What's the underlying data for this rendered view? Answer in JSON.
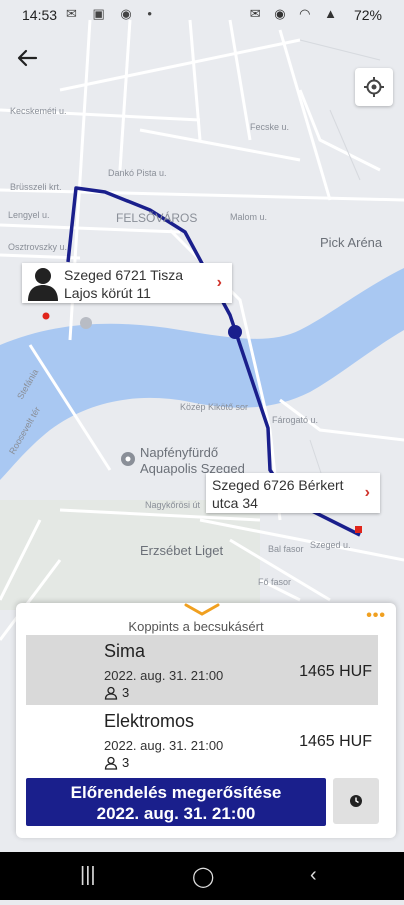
{
  "status": {
    "time": "14:53",
    "battery": "72%"
  },
  "map": {
    "labels": {
      "felsovaros": "FELSŐVÁROS",
      "pick_arena": "Pick Aréna",
      "napfenyfurdo_1": "Napfényfürdő",
      "napfenyfurdo_2": "Aquapolis Szeged",
      "erzsebet_liget": "Erzsébet Liget",
      "kecskemeti": "Kecskeméti u.",
      "brusszeli": "Brüsszeli krt.",
      "lengyel": "Lengyel u.",
      "osztrovszky": "Osztrovszky u.",
      "stefania": "Stefánia",
      "roosevelt": "Roosevelt tér",
      "kozep_kikoto": "Közép Kikötő sor",
      "nagykorosi": "Nagykőrösi út",
      "faragoto": "Fárogató u.",
      "bal_fasor": "Bal fasor",
      "fo_fasor": "Fő fasor",
      "szeged_u": "Szeged u.",
      "csanyi": "Csanyi u.",
      "hollo": "Holló u.",
      "denko": "Dankó Pista u.",
      "hobart": "Hobart basa u.",
      "becsi": "Bécsi krt.",
      "mallom": "Malom u.",
      "fecske": "Fecske u."
    }
  },
  "pickup": {
    "address": "Szeged 6721 Tisza Lajos körút 11",
    "arrow": "›"
  },
  "dropoff": {
    "address": "Szeged 6726 Bérkert utca 34",
    "arrow": "›"
  },
  "panel": {
    "hint": "Koppints a becsukásért",
    "options": [
      {
        "name": "Sima",
        "date": "2022. aug. 31. 21:00",
        "price": "1465 HUF",
        "passengers": "3"
      },
      {
        "name": "Elektromos",
        "date": "2022. aug. 31. 21:00",
        "price": "1465 HUF",
        "passengers": "3"
      }
    ],
    "confirm_line1": "Előrendelés megerősítése",
    "confirm_line2": "2022. aug. 31. 21:00"
  },
  "colors": {
    "route": "#1a1f8c",
    "confirm": "#1a1f8c",
    "river": "#a9c8f2",
    "marker": "#e0251b",
    "accent": "#f0a020"
  },
  "icons": {
    "back": "arrow-left-icon",
    "locate": "crosshair-icon",
    "clock": "clock-icon",
    "person": "person-icon",
    "avatar": "avatar-silhouette-icon",
    "more": "more-dots-icon"
  }
}
